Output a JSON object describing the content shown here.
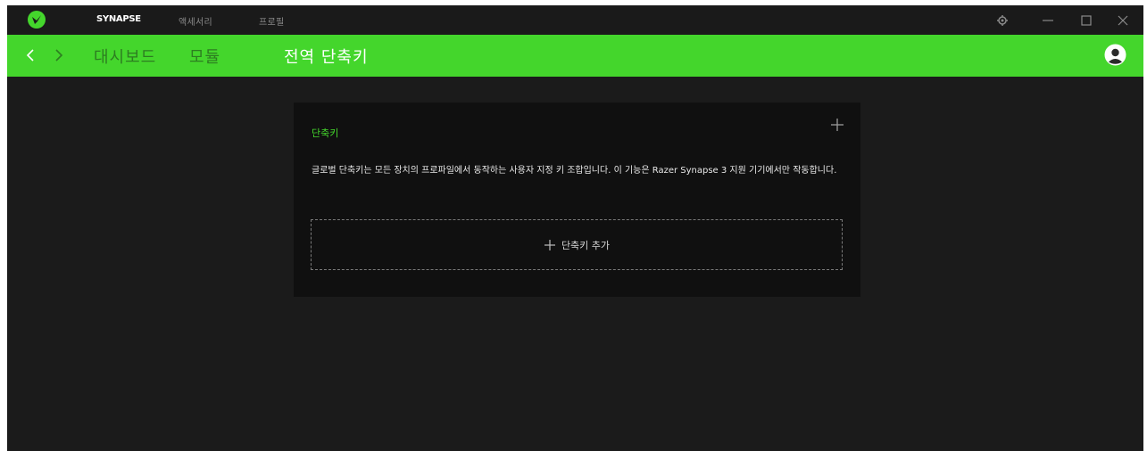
{
  "titlebar": {
    "tabs": [
      {
        "label": "SYNAPSE",
        "active": true
      },
      {
        "label": "액세서리",
        "active": false
      },
      {
        "label": "프로필",
        "active": false
      }
    ],
    "controls": [
      "gear-icon",
      "minimize-icon",
      "maximize-icon",
      "close-icon"
    ]
  },
  "navbar": {
    "back_icon": "chevron-left-icon",
    "forward_icon": "chevron-right-icon",
    "items": [
      {
        "label": "대시보드",
        "active": false
      },
      {
        "label": "모듈",
        "active": false
      },
      {
        "label": "전역 단축키",
        "active": true
      }
    ],
    "avatar_icon": "user-avatar-icon"
  },
  "card": {
    "title": "단축키",
    "add_icon": "plus-icon",
    "description": "글로벌 단축키는 모든 장치의 프로파일에서 동작하는 사용자 지정 키 조합입니다. 이 기능은 Razer Synapse 3 지원 기기에서만 작동합니다.",
    "add_button_label": "단축키 추가"
  },
  "colors": {
    "accent": "#44d62c",
    "background": "#1b1b1b",
    "card": "#101010"
  }
}
